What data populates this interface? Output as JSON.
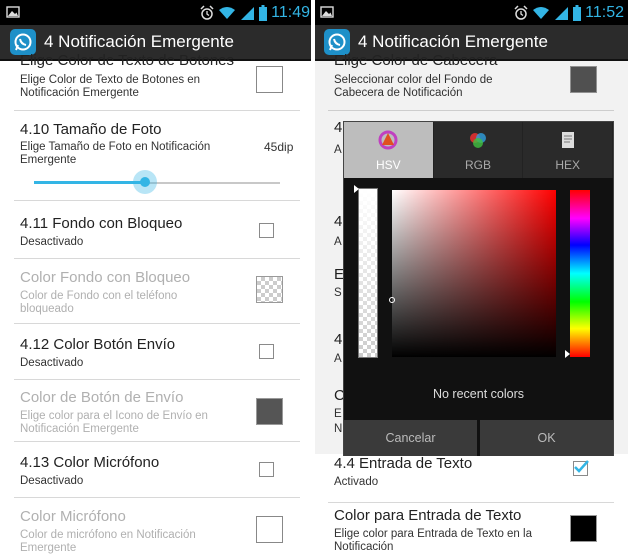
{
  "status_left": {
    "time": "11:49",
    "icons": [
      "image-icon",
      "alarm-icon",
      "wifi-icon",
      "signal-icon",
      "battery-icon"
    ]
  },
  "status_right": {
    "time": "11:52",
    "icons": [
      "image-icon",
      "alarm-icon",
      "wifi-icon",
      "signal-icon",
      "battery-icon"
    ]
  },
  "app_title": "4 Notificación Emergente",
  "left": {
    "items": [
      {
        "title": "Elige Color de Texto de Botones",
        "summary1": "Elige Color de Texto de Botones en",
        "summary2": "Notificación Emergente"
      },
      {
        "title": "4.10 Tamaño de Foto",
        "summary1": "Elige Tamaño de Foto en Notificación",
        "summary2": "Emergente",
        "value": "45dip",
        "slider_fraction": 0.45
      },
      {
        "title": "4.11 Fondo con Bloqueo",
        "summary1": "Desactivado"
      },
      {
        "title": "Color Fondo con Bloqueo",
        "summary1": "Color de Fondo con el teléfono",
        "summary2": "bloqueado"
      },
      {
        "title": "4.12 Color Botón Envío",
        "summary1": "Desactivado"
      },
      {
        "title": "Color de Botón de Envío",
        "summary1": "Elige color para el Icono de Envío en",
        "summary2": "Notificación Emergente"
      },
      {
        "title": "4.13 Color Micrófono",
        "summary1": "Desactivado"
      },
      {
        "title": "Color Micrófono",
        "summary1": "Color de micrófono en Notificación",
        "summary2": "Emergente"
      }
    ]
  },
  "right": {
    "items": [
      {
        "title": "Elige Color de Cabecera",
        "summary1": "Seleccionar color del Fondo de",
        "summary2": "Cabecera de Notificación"
      },
      {
        "title": "4.4 Entrada de Texto",
        "summary1": "Activado"
      },
      {
        "title": "Color para Entrada de Texto",
        "summary1": "Elige color para Entrada de Texto en la",
        "summary2": "Notificación"
      }
    ],
    "hidden_fragments": [
      "4",
      "A",
      "E",
      "S",
      "4",
      "A",
      "C",
      "E",
      "N",
      "E",
      "p"
    ]
  },
  "dialog": {
    "tabs": [
      {
        "label": "HSV",
        "icon": "hsv-icon",
        "active": true
      },
      {
        "label": "RGB",
        "icon": "rgb-icon",
        "active": false
      },
      {
        "label": "HEX",
        "icon": "hex-icon",
        "active": false
      }
    ],
    "no_recent": "No recent colors",
    "cancel": "Cancelar",
    "ok": "OK"
  },
  "colors": {
    "accent": "#33b5e5",
    "actionbar": "#2b2b2b",
    "disabled_text": "#b0b0b0"
  }
}
